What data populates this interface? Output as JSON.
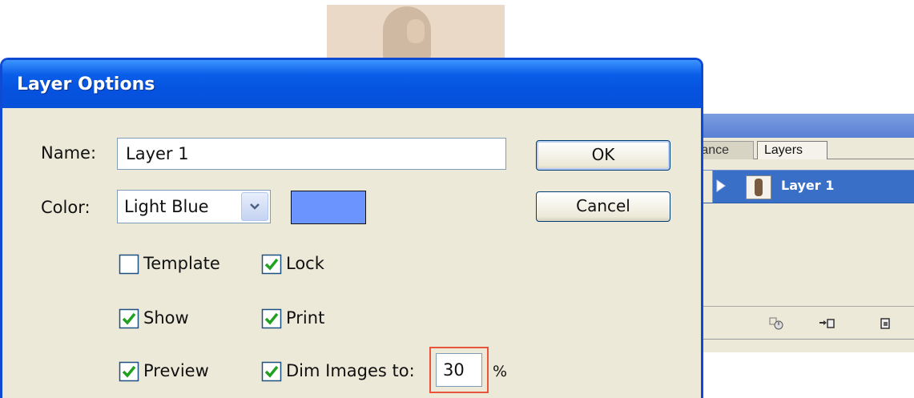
{
  "dialog": {
    "title": "Layer Options",
    "name_label": "Name:",
    "name_value": "Layer 1",
    "color_label": "Color:",
    "color_value": "Light Blue",
    "color_swatch": "#6b94ff",
    "ok_label": "OK",
    "cancel_label": "Cancel",
    "options": {
      "template": {
        "label": "Template",
        "checked": false
      },
      "lock": {
        "label": "Lock",
        "checked": true
      },
      "show": {
        "label": "Show",
        "checked": true
      },
      "print": {
        "label": "Print",
        "checked": true
      },
      "preview": {
        "label": "Preview",
        "checked": true
      },
      "dim_images": {
        "label": "Dim Images to:",
        "checked": true,
        "value": "30",
        "unit": "%"
      }
    }
  },
  "layers_panel": {
    "tabs": [
      {
        "label": "rance"
      },
      {
        "label": "Layers"
      }
    ],
    "layer": {
      "name": "Layer 1"
    },
    "footer_icons": [
      "make-clipping-mask-icon",
      "new-sublayer-icon",
      "new-layer-icon"
    ]
  },
  "colors": {
    "titlebar": "#0553e0",
    "selection": "#3a6fc8",
    "checkmark": "#21a121",
    "highlight": "#e8553a"
  }
}
